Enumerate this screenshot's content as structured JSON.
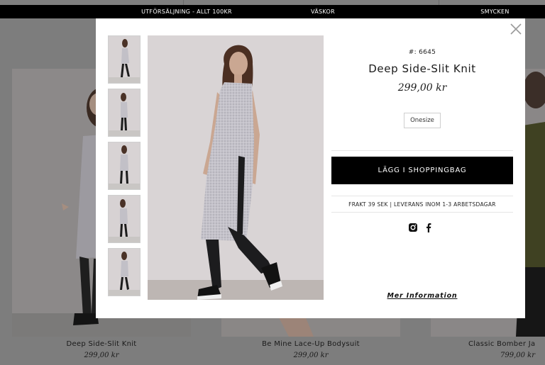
{
  "nav": {
    "items": [
      {
        "label": "UTFÖRSÄLJNING - ALLT 100KR"
      },
      {
        "label": "VÄSKOR"
      },
      {
        "label": "SMYCKEN"
      }
    ]
  },
  "grid": {
    "products": [
      {
        "name": "Deep Side-Slit Knit",
        "price": "299,00 kr"
      },
      {
        "name": "Be Mine Lace-Up Bodysuit",
        "price": "299,00 kr"
      },
      {
        "name": "Classic Bomber Ja",
        "price": "799,00 kr"
      }
    ]
  },
  "modal": {
    "sku": "#: 6645",
    "name": "Deep Side-Slit Knit",
    "price": "299,00 kr",
    "size_option": "Onesize",
    "add_to_bag": "LÄGG I SHOPPINGBAG",
    "shipping": "FRAKT 39 SEK | LEVERANS INOM 1-3 ARBETSDAGAR",
    "more_info": "Mer Information",
    "thumbnail_count": 5,
    "social": [
      "instagram-icon",
      "facebook-icon"
    ]
  },
  "colors": {
    "overlay": "#7d7d7d",
    "nav_bar": "#000000",
    "button": "#000000",
    "modal_bg": "#ffffff"
  }
}
